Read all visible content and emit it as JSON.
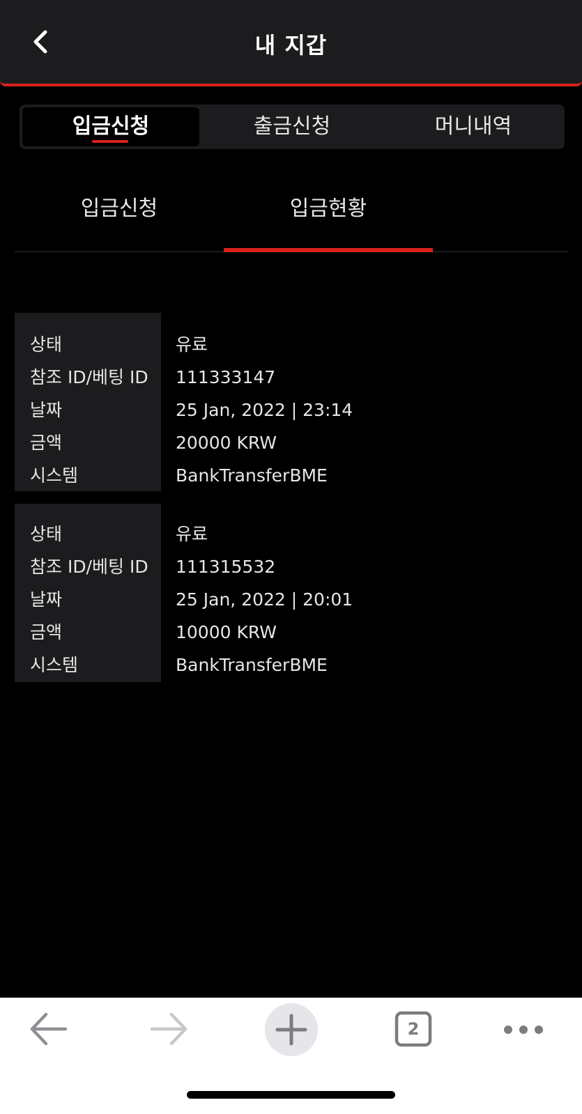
{
  "header": {
    "title": "내 지갑"
  },
  "segment_tabs": [
    {
      "label": "입금신청",
      "active": true
    },
    {
      "label": "출금신청",
      "active": false
    },
    {
      "label": "머니내역",
      "active": false
    }
  ],
  "sub_tabs": [
    {
      "label": "입금신청",
      "active": false
    },
    {
      "label": "입금현황",
      "active": true
    }
  ],
  "record_labels": {
    "status": "상태",
    "ref_id": "참조 ID/베팅 ID",
    "date": "날짜",
    "amount": "금액",
    "system": "시스템"
  },
  "records": [
    {
      "status": "유료",
      "ref_id": "111333147",
      "date": "25 Jan, 2022 | 23:14",
      "amount": "20000 KRW",
      "system": "BankTransferBME"
    },
    {
      "status": "유료",
      "ref_id": "111315532",
      "date": "25 Jan, 2022 | 20:01",
      "amount": "10000 KRW",
      "system": "BankTransferBME"
    }
  ],
  "browser_bar": {
    "tab_count": "2"
  },
  "colors": {
    "accent": "#d9221c",
    "panel": "#1c1c1f",
    "background": "#000000"
  }
}
